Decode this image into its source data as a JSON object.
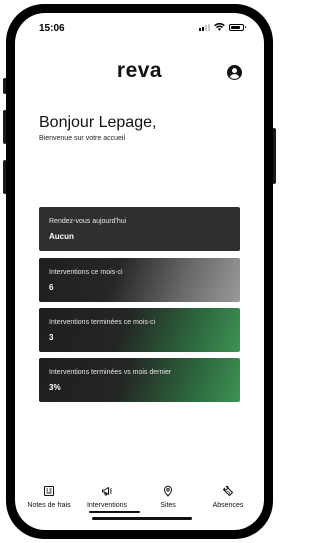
{
  "status_bar": {
    "time": "15:06",
    "signal_icon": "cellular-signal-icon",
    "wifi_icon": "wifi-icon",
    "battery_icon": "battery-icon",
    "battery_level": 0.85
  },
  "header": {
    "app_name": "reva",
    "account_icon": "account-circle-icon"
  },
  "greeting": {
    "title": "Bonjour Lepage,",
    "subtitle": "Bienvenue sur votre accueil"
  },
  "cards": [
    {
      "label": "Rendez-vous aujourd'hui",
      "value": "Aucun"
    },
    {
      "label": "Interventions ce mois-ci",
      "value": "6"
    },
    {
      "label": "Interventions terminées ce mois-ci",
      "value": "3"
    },
    {
      "label": "Interventions terminées vs mois dernier",
      "value": "3%"
    }
  ],
  "bottom_nav": {
    "items": [
      {
        "label": "Notes de frais",
        "icon": "receipt-icon"
      },
      {
        "label": "Interventions",
        "icon": "megaphone-icon"
      },
      {
        "label": "Sites",
        "icon": "location-pin-icon"
      },
      {
        "label": "Absences",
        "icon": "ticket-icon"
      }
    ],
    "active_item": "Interventions"
  },
  "colors": {
    "card_dark": "#2f2f30",
    "card_gray_accent": "#9a9a9c",
    "card_green_accent": "#3f9254",
    "text_primary": "#111111"
  }
}
